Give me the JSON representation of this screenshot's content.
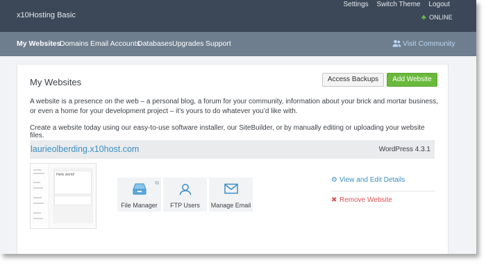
{
  "app": {
    "brand": "x10Hosting Basic",
    "status": "ONLINE"
  },
  "toplinks": {
    "settings": "Settings",
    "switch_theme": "Switch Theme",
    "logout": "Logout"
  },
  "nav": {
    "items": [
      {
        "label": "My Websites",
        "active": true
      },
      {
        "label": "Domains"
      },
      {
        "label": "Email Accounts"
      },
      {
        "label": "Databases"
      },
      {
        "label": "Upgrades"
      },
      {
        "label": "Support"
      }
    ],
    "visit_community": "Visit Community"
  },
  "page": {
    "title": "My Websites",
    "access_backups": "Access Backups",
    "add_website": "Add Website",
    "description": "A website is a presence on the web – a personal blog, a forum for your community, information about your brick and mortar business, or even a home for your development project – it’s yours to do whatever you’d like with.",
    "cta": "Create a website today using our easy-to-use software installer, our SiteBuilder, or by manually editing or uploading your website files."
  },
  "website": {
    "domain": "laurieolberding.x10host.com",
    "software": "WordPress 4.3.1",
    "thumbnail_text": "Hello world!",
    "tools": [
      {
        "label": "File Manager",
        "icon": "file-manager-icon"
      },
      {
        "label": "FTP Users",
        "icon": "ftp-users-icon"
      },
      {
        "label": "Manage Email",
        "icon": "mail-icon"
      }
    ],
    "view_details": "View and Edit Details",
    "remove": "Remove Website"
  },
  "colors": {
    "topbar": "#3c4857",
    "nav": "#6f7e8e",
    "link": "#3a8fc5",
    "add_button": "#6ab93c",
    "danger": "#d9534f",
    "online": "#6cc24a"
  }
}
